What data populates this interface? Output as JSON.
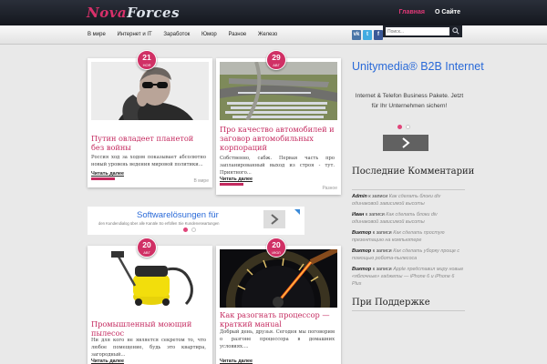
{
  "site": {
    "logo_part1": "Nova",
    "logo_part2": "Forces",
    "top_links": [
      "Главная",
      "О Сайте"
    ],
    "menu": [
      "В мире",
      "Интернет и IT",
      "Заработок",
      "Юмор",
      "Разное",
      "Железо"
    ],
    "social": [
      "vk",
      "t",
      "f"
    ],
    "search_placeholder": "Поиск..."
  },
  "posts": [
    {
      "day": "21",
      "month": "Ноя",
      "title": "Путин овладеет планетой без войны",
      "excerpt": "Россия ход за ходом показывает абсолютно новый уровень ведения мировой политики...",
      "more": "Читать далее",
      "category": "В мире",
      "image": "man-in-sunglasses"
    },
    {
      "day": "29",
      "month": "Авг",
      "title": "Про качество автомобилей и заговор автомобильных корпораций",
      "excerpt": "Собственно, сабж. Первая часть про запланированный выход из строя - тут. Приятного...",
      "more": "Читать далее",
      "category": "Разное",
      "image": "car-parking-aerial"
    },
    {
      "day": "20",
      "month": "Авг",
      "title": "Промышленный моющий пылесос",
      "excerpt": "Ни для кого не является секретом то, что любое помещение, будь это квартира, загородный...",
      "more": "Читать далее",
      "category": "",
      "image": "yellow-vacuum"
    },
    {
      "day": "20",
      "month": "Июл",
      "title": "Как разогнать процессор — краткий манual",
      "excerpt": "Добрый день, друзья. Сегодня мы поговорим о разгоне процессора в домашних условиях....",
      "more": "Читать далее",
      "category": "",
      "image": "speedometer"
    }
  ],
  "ad_strip": {
    "title": "Softwarelösungen für",
    "subtitle": "den Kundendialog über alle Kanäle So erfüllen Sie Kundenerwartungen"
  },
  "sidebar_ad": {
    "title": "Unitymedia® B2B Internet",
    "body": "Internet & Telefon Business Pakete. Jetzt für Ihr Unternehmen sichern!"
  },
  "sidebar": {
    "comments_title": "Последние Комментарии",
    "comments": [
      {
        "author": "Admin",
        "to": "к записи",
        "post": "Как сделать блоки div одинаковой зависимой высоты"
      },
      {
        "author": "Иван",
        "to": "к записи",
        "post": "Как сделать блоки div одинаковой зависимой высоты"
      },
      {
        "author": "Виктор",
        "to": "к записи",
        "post": "Как сделать простую презентацию на компьютере"
      },
      {
        "author": "Виктор",
        "to": "к записи",
        "post": "Как сделать уборку проще с помощью робота-пылесоса"
      },
      {
        "author": "Виктор",
        "to": "к записи",
        "post": "Apple представил миру новые «яблочные» гаджеты — iPhone 6 и iPhone 6 Plus"
      }
    ],
    "support_title": "При Поддержке"
  },
  "colors": {
    "accent": "#c42a5f",
    "header": "#1a1d24",
    "ad_blue": "#2a6ad8"
  }
}
